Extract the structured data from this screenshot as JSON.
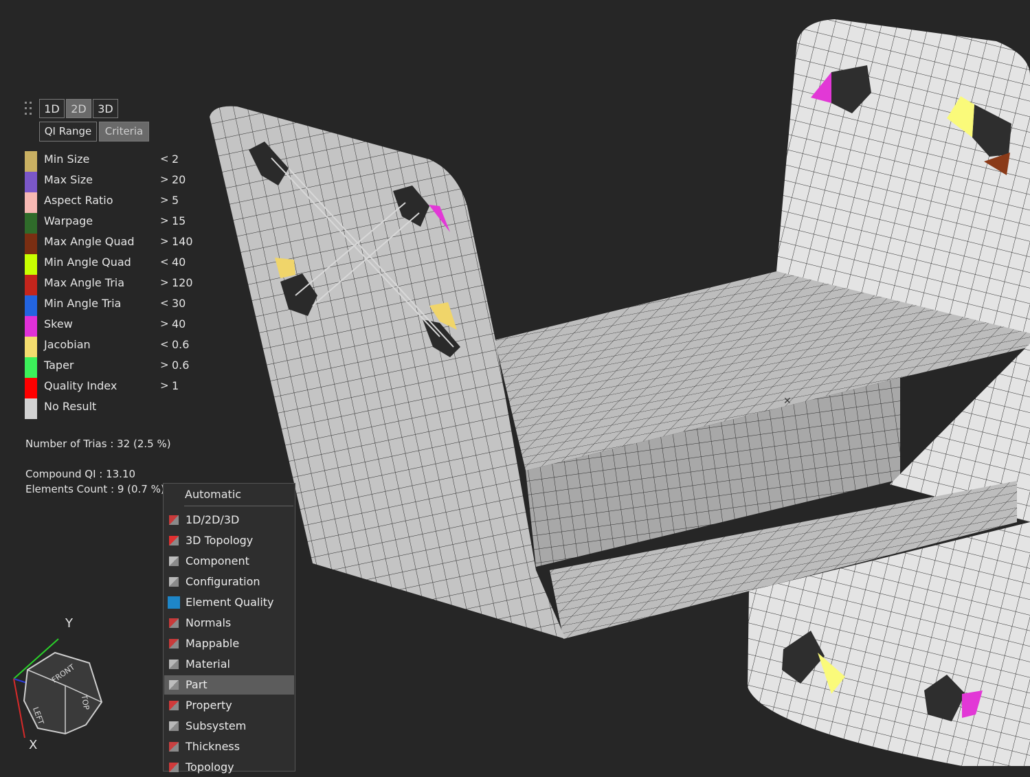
{
  "dimension_tabs": [
    {
      "label": "1D",
      "active": false
    },
    {
      "label": "2D",
      "active": true
    },
    {
      "label": "3D",
      "active": false
    }
  ],
  "sub_tabs": [
    {
      "label": "QI Range",
      "active": false
    },
    {
      "label": "Criteria",
      "active": true
    }
  ],
  "legend": [
    {
      "name": "Min Size",
      "op": "<",
      "value": "2",
      "color": "#c9b062"
    },
    {
      "name": "Max Size",
      "op": ">",
      "value": "20",
      "color": "#7b57c8"
    },
    {
      "name": "Aspect Ratio",
      "op": ">",
      "value": "5",
      "color": "#f7b8b3"
    },
    {
      "name": "Warpage",
      "op": ">",
      "value": "15",
      "color": "#2f6b2a"
    },
    {
      "name": "Max Angle Quad",
      "op": ">",
      "value": "140",
      "color": "#7a2e12"
    },
    {
      "name": "Min Angle Quad",
      "op": "<",
      "value": "40",
      "color": "#c8ff00"
    },
    {
      "name": "Max Angle Tria",
      "op": ">",
      "value": "120",
      "color": "#c4251c"
    },
    {
      "name": "Min Angle Tria",
      "op": "<",
      "value": "30",
      "color": "#2364e0"
    },
    {
      "name": "Skew",
      "op": ">",
      "value": "40",
      "color": "#e030d8"
    },
    {
      "name": "Jacobian",
      "op": "<",
      "value": "0.6",
      "color": "#f3dc6e"
    },
    {
      "name": "Taper",
      "op": ">",
      "value": "0.6",
      "color": "#3cf05a"
    },
    {
      "name": "Quality Index",
      "op": ">",
      "value": "1",
      "color": "#ff0000"
    },
    {
      "name": "No Result",
      "op": "",
      "value": "",
      "color": "#d2d2d2"
    }
  ],
  "stats": {
    "trias": "Number of Trias : 32 (2.5 %)",
    "compound_qi": "Compound QI : 13.10",
    "elements_count": "Elements Count : 9 (0.7 %)"
  },
  "context_menu": {
    "header": "Automatic",
    "items": [
      {
        "label": "1D/2D/3D",
        "icon": "1d-2d-3d-icon"
      },
      {
        "label": "3D Topology",
        "icon": "3d-topology-icon"
      },
      {
        "label": "Component",
        "icon": "component-icon"
      },
      {
        "label": "Configuration",
        "icon": "configuration-icon"
      },
      {
        "label": "Element Quality",
        "icon": "element-quality-icon",
        "selected": true
      },
      {
        "label": "Normals",
        "icon": "normals-icon"
      },
      {
        "label": "Mappable",
        "icon": "mappable-icon"
      },
      {
        "label": "Material",
        "icon": "material-icon"
      },
      {
        "label": "Part",
        "icon": "part-icon",
        "hover": true
      },
      {
        "label": "Property",
        "icon": "property-icon"
      },
      {
        "label": "Subsystem",
        "icon": "subsystem-icon"
      },
      {
        "label": "Thickness",
        "icon": "thickness-icon"
      },
      {
        "label": "Topology",
        "icon": "topology-icon"
      }
    ]
  },
  "view_cube": {
    "faces": [
      "FRONT",
      "LEFT",
      "TOP"
    ],
    "axes": [
      "Y",
      "X"
    ]
  },
  "colors": {
    "background": "#262626",
    "mesh_light": "#e6e6e6",
    "mesh_mid": "#c8c8c8",
    "mesh_dark": "#a6a6a6",
    "highlight_blue": "#1e86c8"
  }
}
